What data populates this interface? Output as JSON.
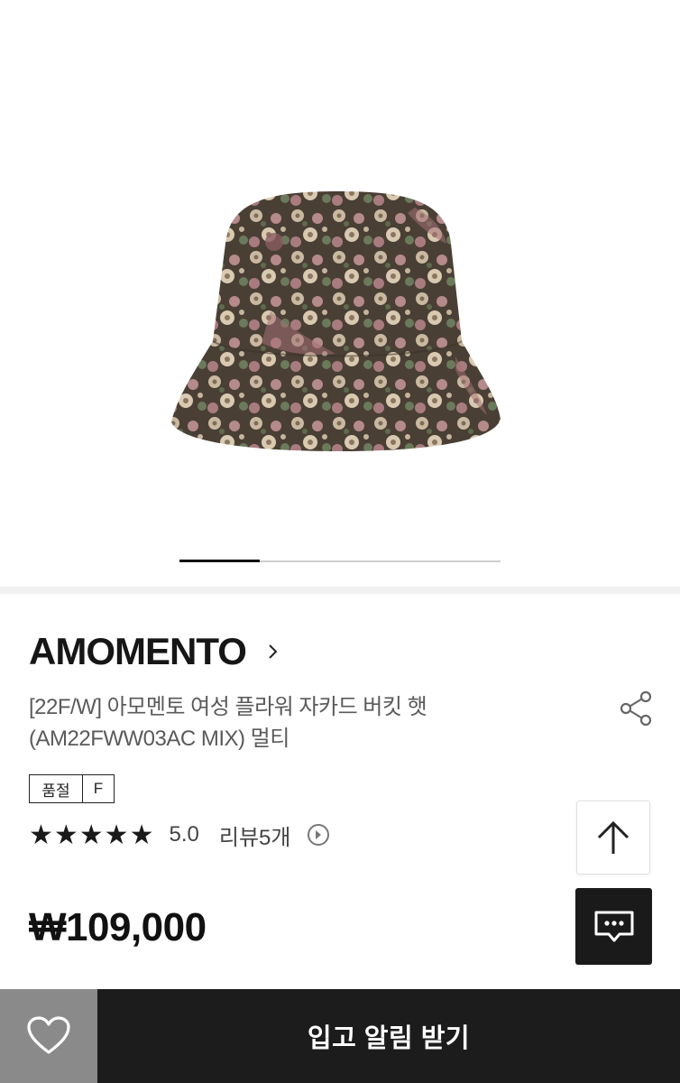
{
  "brand": {
    "name": "AMOMENTO"
  },
  "product": {
    "title_line1": "[22F/W] 아모멘토 여성 플라워 자카드 버킷 햇",
    "title_line2": "(AM22FWW03AC MIX) 멀티"
  },
  "status": {
    "label": "품절",
    "value": "F"
  },
  "rating": {
    "stars": "★★★★★",
    "score": "5.0",
    "reviews": "리뷰5개"
  },
  "price": "₩109,000",
  "gallery": {
    "current_slide": 1,
    "total_slides": 4
  },
  "cta": {
    "notify_label": "입고 알림 받기"
  },
  "icons": {
    "brand_chevron": "chevron-right-icon",
    "share": "share-icon",
    "review_arrow": "circle-arrow-right-icon",
    "top": "arrow-up-icon",
    "chat": "chat-bubble-icon",
    "wish": "heart-icon"
  }
}
